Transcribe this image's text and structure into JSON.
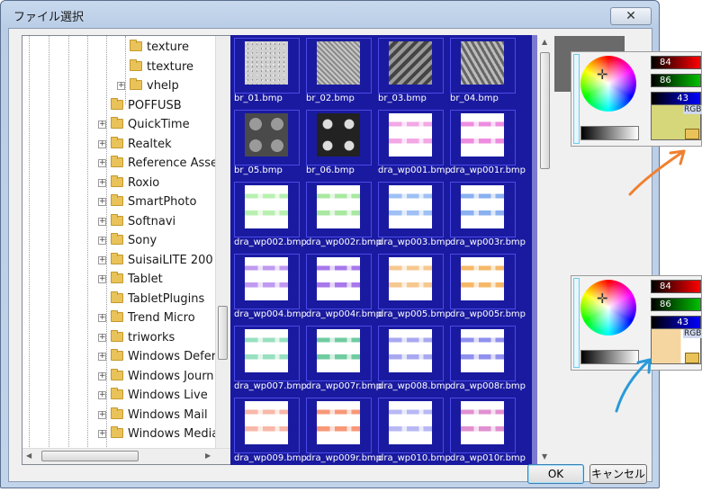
{
  "window": {
    "title": "ファイル選択",
    "close_glyph": "✕"
  },
  "tree": {
    "rows": [
      {
        "label": "texture",
        "level": 2,
        "expander": ""
      },
      {
        "label": "ttexture",
        "level": 2,
        "expander": ""
      },
      {
        "label": "vhelp",
        "level": 2,
        "expander": "+"
      },
      {
        "label": "POFFUSB",
        "level": 1,
        "expander": ""
      },
      {
        "label": "QuickTime",
        "level": 1,
        "expander": "+"
      },
      {
        "label": "Realtek",
        "level": 1,
        "expander": "+"
      },
      {
        "label": "Reference Asse",
        "level": 1,
        "expander": "+"
      },
      {
        "label": "Roxio",
        "level": 1,
        "expander": "+"
      },
      {
        "label": "SmartPhoto",
        "level": 1,
        "expander": "+"
      },
      {
        "label": "Softnavi",
        "level": 1,
        "expander": "+"
      },
      {
        "label": "Sony",
        "level": 1,
        "expander": "+"
      },
      {
        "label": "SuisaiLITE 200",
        "level": 1,
        "expander": "+"
      },
      {
        "label": "Tablet",
        "level": 1,
        "expander": "+"
      },
      {
        "label": "TabletPlugins",
        "level": 1,
        "expander": ""
      },
      {
        "label": "Trend Micro",
        "level": 1,
        "expander": "+"
      },
      {
        "label": "triworks",
        "level": 1,
        "expander": "+"
      },
      {
        "label": "Windows Defer",
        "level": 1,
        "expander": "+"
      },
      {
        "label": "Windows Journ",
        "level": 1,
        "expander": "+"
      },
      {
        "label": "Windows Live",
        "level": 1,
        "expander": "+"
      },
      {
        "label": "Windows Mail",
        "level": 1,
        "expander": "+"
      },
      {
        "label": "Windows Media",
        "level": 1,
        "expander": "+"
      }
    ]
  },
  "files": [
    {
      "name": "br_01.bmp",
      "kind": "noise",
      "color": "#d0d0d0"
    },
    {
      "name": "br_02.bmp",
      "kind": "mesh",
      "color": "#a8a8a8"
    },
    {
      "name": "br_03.bmp",
      "kind": "diag",
      "color": "#7a7a7a"
    },
    {
      "name": "br_04.bmp",
      "kind": "zigzag",
      "color": "#9a9a9a"
    },
    {
      "name": "br_05.bmp",
      "kind": "circles",
      "color": "#6a6a6a"
    },
    {
      "name": "br_06.bmp",
      "kind": "circles-dark",
      "color": "#3a3a3a"
    },
    {
      "name": "dra_wp001.bmp",
      "kind": "plaid",
      "color": "#f3a8e6"
    },
    {
      "name": "dra_wp001r.bmp",
      "kind": "plaid",
      "color": "#ee8ce0"
    },
    {
      "name": "dra_wp002.bmp",
      "kind": "plaid",
      "color": "#b8f0b0"
    },
    {
      "name": "dra_wp002r.bmp",
      "kind": "plaid",
      "color": "#a8e8a0"
    },
    {
      "name": "dra_wp003.bmp",
      "kind": "plaid",
      "color": "#9ec0f4"
    },
    {
      "name": "dra_wp003r.bmp",
      "kind": "plaid",
      "color": "#8ab0f0"
    },
    {
      "name": "dra_wp004.bmp",
      "kind": "plaid",
      "color": "#c09af0"
    },
    {
      "name": "dra_wp004r.bmp",
      "kind": "plaid",
      "color": "#a878ea"
    },
    {
      "name": "dra_wp005.bmp",
      "kind": "plaid",
      "color": "#f6c890"
    },
    {
      "name": "dra_wp005r.bmp",
      "kind": "plaid",
      "color": "#f6b868"
    },
    {
      "name": "dra_wp007.bmp",
      "kind": "plaid",
      "color": "#98e0c0"
    },
    {
      "name": "dra_wp007r.bmp",
      "kind": "plaid",
      "color": "#70cca0"
    },
    {
      "name": "dra_wp008.bmp",
      "kind": "plaid",
      "color": "#a8a8f0"
    },
    {
      "name": "dra_wp008r.bmp",
      "kind": "plaid",
      "color": "#9090ee"
    },
    {
      "name": "dra_wp009.bmp",
      "kind": "plaid",
      "color": "#f8b8a8"
    },
    {
      "name": "dra_wp009r.bmp",
      "kind": "plaid",
      "color": "#f89878"
    },
    {
      "name": "dra_wp010.bmp",
      "kind": "plaid",
      "color": "#b8b8f4"
    },
    {
      "name": "dra_wp010r.bmp",
      "kind": "plaid",
      "color": "#e090d0"
    }
  ],
  "buttons": {
    "ok": "OK",
    "cancel": "キャンセル"
  },
  "pickers": [
    {
      "r": "84",
      "g": "86",
      "b": "43",
      "rgb_label": "RGB",
      "swatch_color": "#d6d67a"
    },
    {
      "r": "84",
      "g": "86",
      "b": "43",
      "rgb_label": "RGB",
      "swatch_color": "#f6d6a0"
    }
  ],
  "annotations": {
    "orange": "#f08030",
    "blue": "#2a9ad8"
  }
}
